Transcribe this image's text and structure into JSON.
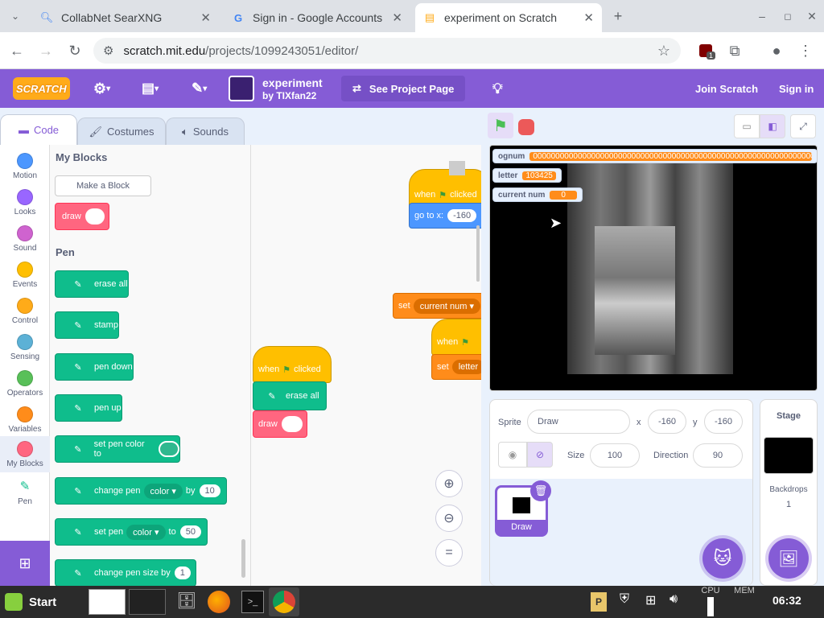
{
  "browser": {
    "tabs": [
      {
        "title": "CollabNet SearXNG",
        "icon": "search-icon"
      },
      {
        "title": "Sign in - Google Accounts",
        "icon": "google-icon"
      },
      {
        "title": "experiment on Scratch",
        "icon": "scratch-icon"
      }
    ],
    "url_domain": "scratch.mit.edu",
    "url_path": "/projects/1099243051/editor/",
    "ext_badge": "1"
  },
  "menu": {
    "logo": "SCRATCH",
    "project_title": "experiment",
    "author": "by TIXfan22",
    "see_project": "See Project Page",
    "join": "Join Scratch",
    "signin": "Sign in"
  },
  "editor_tabs": {
    "code": "Code",
    "costumes": "Costumes",
    "sounds": "Sounds"
  },
  "categories": [
    {
      "label": "Motion",
      "color": "#4c97ff"
    },
    {
      "label": "Looks",
      "color": "#9966ff"
    },
    {
      "label": "Sound",
      "color": "#cf63cf"
    },
    {
      "label": "Events",
      "color": "#ffbf00"
    },
    {
      "label": "Control",
      "color": "#ffab19"
    },
    {
      "label": "Sensing",
      "color": "#5cb1d6"
    },
    {
      "label": "Operators",
      "color": "#59c059"
    },
    {
      "label": "Variables",
      "color": "#ff8c1a"
    },
    {
      "label": "My Blocks",
      "color": "#ff6680"
    },
    {
      "label": "Pen",
      "color": "#0fbd8c"
    }
  ],
  "palette": {
    "myblocks_heading": "My Blocks",
    "make_block": "Make a Block",
    "draw_block": "draw",
    "pen_heading": "Pen",
    "erase_all": "erase all",
    "stamp": "stamp",
    "pen_down": "pen down",
    "pen_up": "pen up",
    "set_pen_color_to": "set pen color to",
    "change_pen": "change pen",
    "color": "color",
    "by": "by",
    "change_value": "10",
    "set_pen": "set pen",
    "to": "to",
    "set_value": "50",
    "change_pen_size_by": "change pen size by",
    "size_value": "1"
  },
  "script": {
    "when": "when",
    "clicked": "clicked",
    "go_to_x": "go to x:",
    "x_value": "-160",
    "set": "set",
    "current_num": "current num",
    "letter": "letter",
    "erase_all": "erase all",
    "draw": "draw"
  },
  "monitors": {
    "ognum_label": "ognum",
    "ognum_value": "000000000000000000000000000000000000000000000000000000000000000000000000000000000000",
    "letter_label": "letter",
    "letter_value": "103425",
    "current_num_label": "current num",
    "current_num_value": "0"
  },
  "sprite": {
    "sprite_label": "Sprite",
    "name": "Draw",
    "x_label": "x",
    "x": "-160",
    "y_label": "y",
    "y": "-160",
    "size_label": "Size",
    "size": "100",
    "direction_label": "Direction",
    "direction": "90",
    "thumb_name": "Draw"
  },
  "stage_panel": {
    "title": "Stage",
    "backdrops_label": "Backdrops",
    "backdrops_count": "1"
  },
  "taskbar": {
    "start": "Start",
    "cpu": "CPU",
    "mem": "MEM",
    "time": "06:32"
  }
}
